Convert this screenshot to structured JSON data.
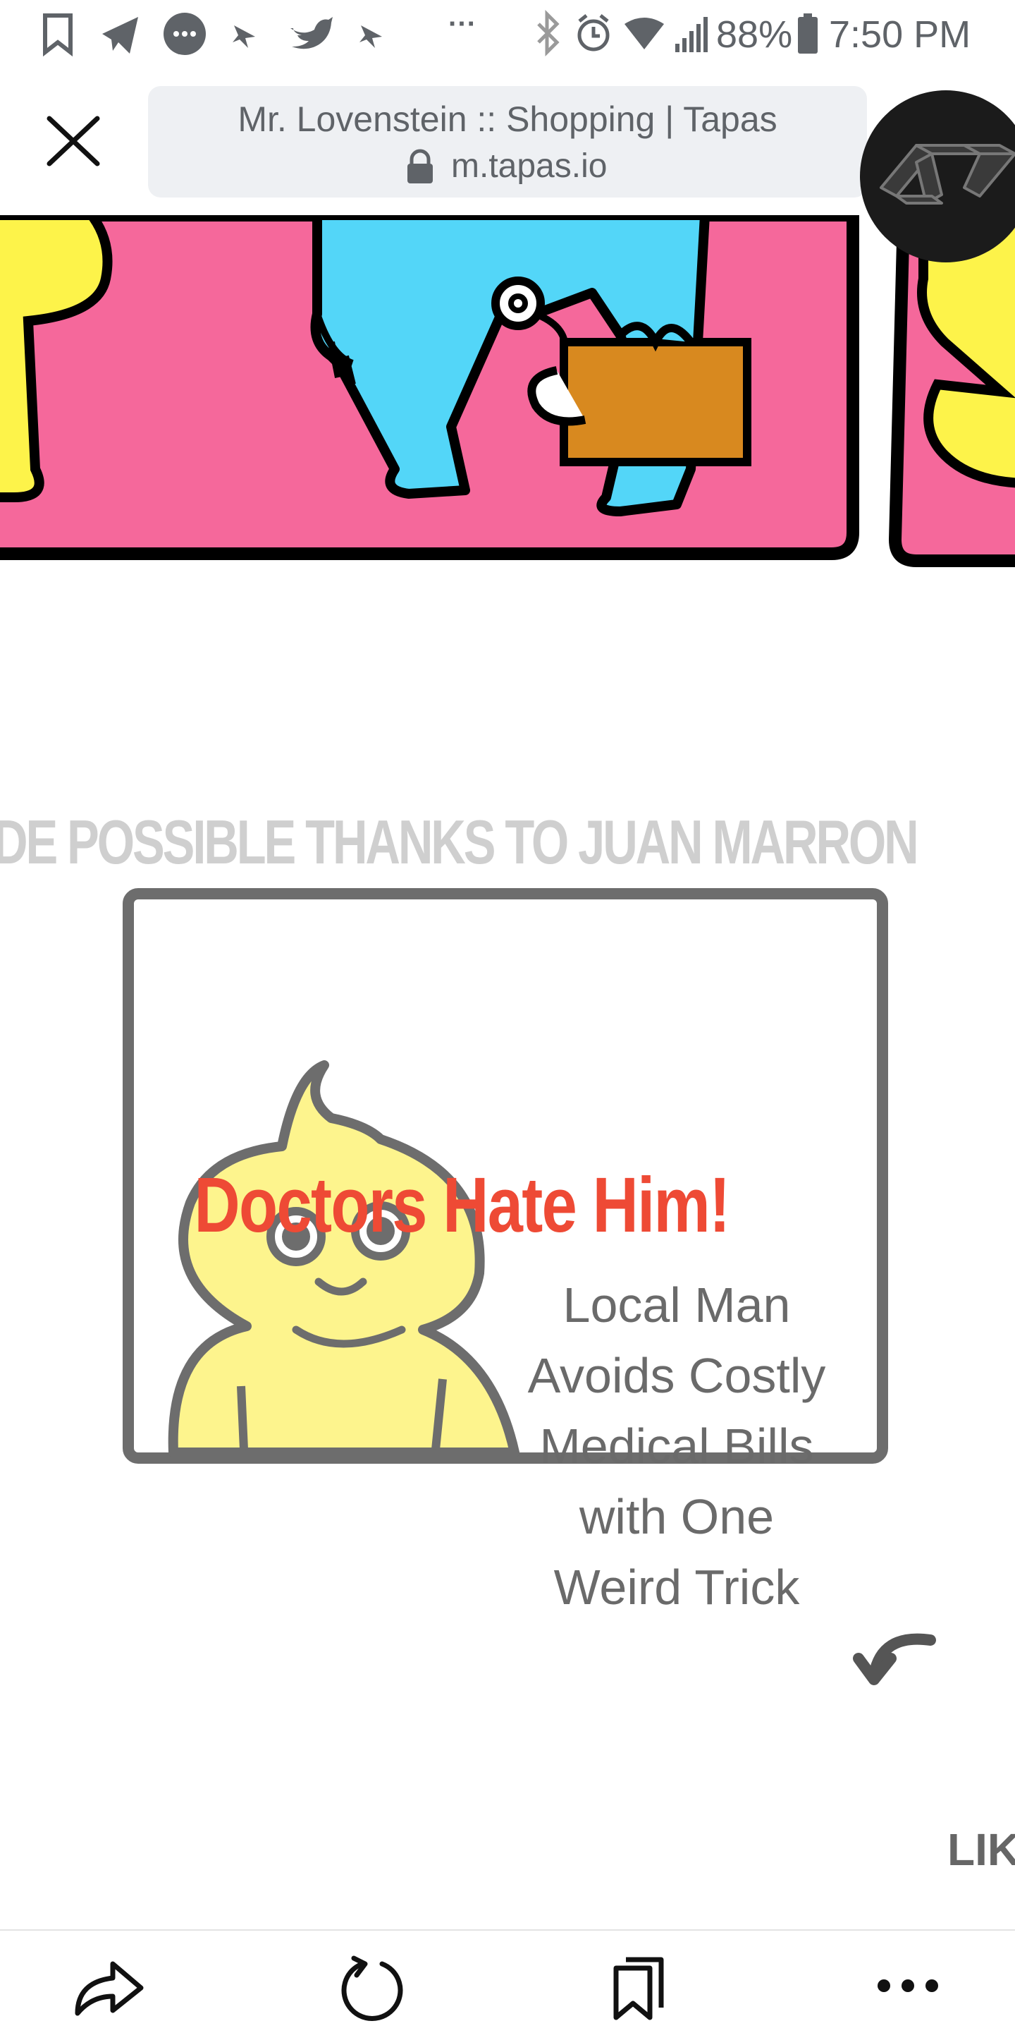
{
  "status_bar": {
    "more_dots": "···",
    "battery_percent": "88%",
    "time": "7:50 PM",
    "icons": [
      "bookmark-flag-icon",
      "telegram-icon",
      "messenger-icon",
      "hummingbird-icon",
      "twitter-icon",
      "hummingbird-icon",
      "bluetooth-icon",
      "alarm-icon",
      "wifi-icon",
      "signal-icon",
      "battery-icon"
    ]
  },
  "browser": {
    "close_icon": "close-icon",
    "page_title": "Mr. Lovenstein :: Shopping | Tapas",
    "url": "m.tapas.io",
    "lock_icon": "lock-icon",
    "app_icon": "browser-app-logo-icon"
  },
  "comic": {
    "credit": "DE POSSIBLE THANKS TO JUAN MARRON",
    "panel_colors": {
      "pink": "#f5689b",
      "blue": "#53d6f8",
      "yellow": "#fdf34a",
      "briefcase": "#d8891f"
    },
    "ad": {
      "headline": "Doctors Hate Him!",
      "lines": [
        "Local Man",
        "Avoids Costly",
        "Medical Bills",
        "with One",
        "Weird Trick"
      ],
      "colors": {
        "headline": "#ee4a35",
        "face": "#fdf48d",
        "border": "#6d6d6d"
      }
    },
    "like_label": "LIK"
  },
  "bottom_nav": {
    "items": [
      "share-icon",
      "refresh-icon",
      "bookmarks-icon",
      "more-icon"
    ]
  }
}
